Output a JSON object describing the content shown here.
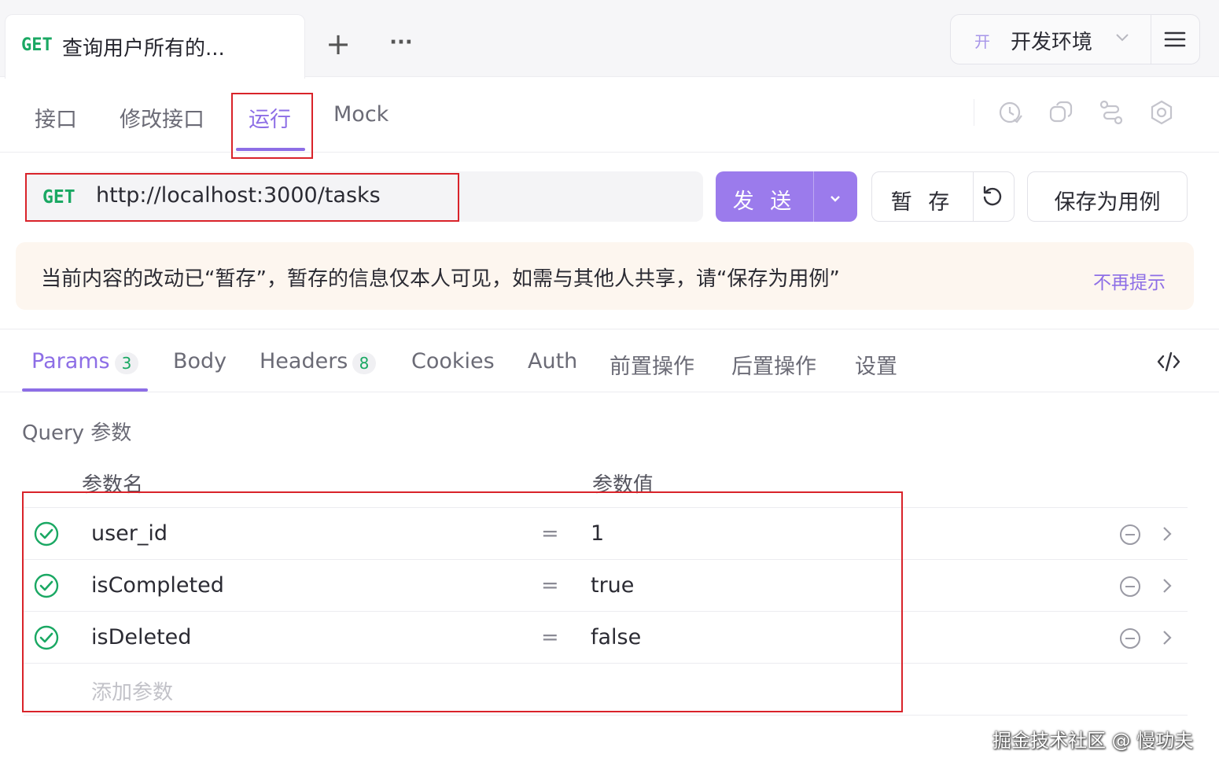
{
  "top_tab": {
    "method": "GET",
    "title": "查询用户所有的..."
  },
  "environment": {
    "badge": "开",
    "name": "开发环境"
  },
  "sub_tabs": [
    "接口",
    "修改接口",
    "运行",
    "Mock"
  ],
  "request": {
    "method": "GET",
    "url": "http://localhost:3000/tasks",
    "send_label": "发 送",
    "stash_label": "暂 存",
    "save_case_label": "保存为用例"
  },
  "notice": {
    "message": "当前内容的改动已“暂存”，暂存的信息仅本人可见，如需与其他人共享，请“保存为用例”",
    "dismiss": "不再提示"
  },
  "param_tabs": [
    {
      "label": "Params",
      "count": "3"
    },
    {
      "label": "Body"
    },
    {
      "label": "Headers",
      "count": "8"
    },
    {
      "label": "Cookies"
    },
    {
      "label": "Auth"
    },
    {
      "label": "前置操作"
    },
    {
      "label": "后置操作"
    },
    {
      "label": "设置"
    }
  ],
  "query": {
    "title": "Query 参数",
    "col_name": "参数名",
    "col_value": "参数值",
    "rows": [
      {
        "name": "user_id",
        "eq": "=",
        "value": "1"
      },
      {
        "name": "isCompleted",
        "eq": "=",
        "value": "true"
      },
      {
        "name": "isDeleted",
        "eq": "=",
        "value": "false"
      }
    ],
    "add_placeholder": "添加参数"
  },
  "watermark": "掘金技术社区 @ 慢功夫",
  "colors": {
    "accent": "#8d6ee6",
    "method_get": "#1aa863",
    "highlight_box": "#d9232a",
    "send_bg": "#9b7bec"
  },
  "icons": [
    "plus-icon",
    "more-icon",
    "chevron-down-icon",
    "hamburger-menu-icon",
    "clock-check-icon",
    "copy-icon",
    "share-route-icon",
    "settings-icon",
    "reload-icon",
    "code-icon",
    "check-circle-icon",
    "minus-circle-icon",
    "chevron-right-icon"
  ]
}
